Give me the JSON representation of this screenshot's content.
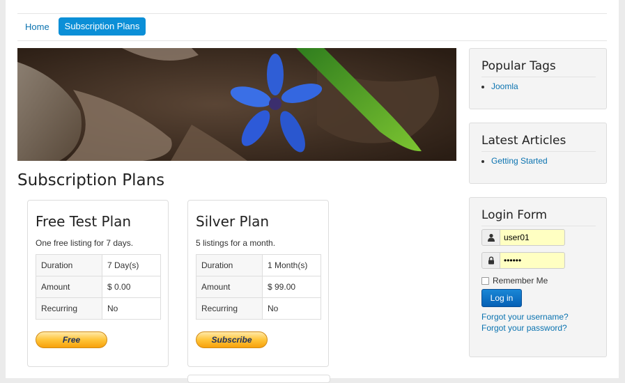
{
  "nav": {
    "items": [
      {
        "label": "Home",
        "active": false
      },
      {
        "label": "Subscription Plans",
        "active": true
      }
    ]
  },
  "banner": {
    "alt": "blue flower on dry leaves",
    "icon": "photo-banner"
  },
  "main": {
    "title": "Subscription Plans",
    "plans": [
      {
        "name": "Free Test Plan",
        "description": "One free listing for 7 days.",
        "rows": [
          {
            "key": "Duration",
            "value": "7 Day(s)"
          },
          {
            "key": "Amount",
            "value": "$ 0.00"
          },
          {
            "key": "Recurring",
            "value": "No"
          }
        ],
        "button": "Free"
      },
      {
        "name": "Silver Plan",
        "description": "5 listings for a month.",
        "rows": [
          {
            "key": "Duration",
            "value": "1 Month(s)"
          },
          {
            "key": "Amount",
            "value": "$ 99.00"
          },
          {
            "key": "Recurring",
            "value": "No"
          }
        ],
        "button": "Subscribe"
      }
    ]
  },
  "sidebar": {
    "popular_tags": {
      "title": "Popular Tags",
      "items": [
        "Joomla"
      ]
    },
    "latest_articles": {
      "title": "Latest Articles",
      "items": [
        "Getting Started"
      ]
    },
    "login": {
      "title": "Login Form",
      "username": "user01",
      "password": "••••••",
      "remember": "Remember Me",
      "button": "Log in",
      "forgot_username": "Forgot your username?",
      "forgot_password": "Forgot your password?"
    }
  },
  "colors": {
    "accent": "#0b8fd7",
    "link": "#0b73b0",
    "button": "#0560b5",
    "paypal": "#ffc439"
  }
}
